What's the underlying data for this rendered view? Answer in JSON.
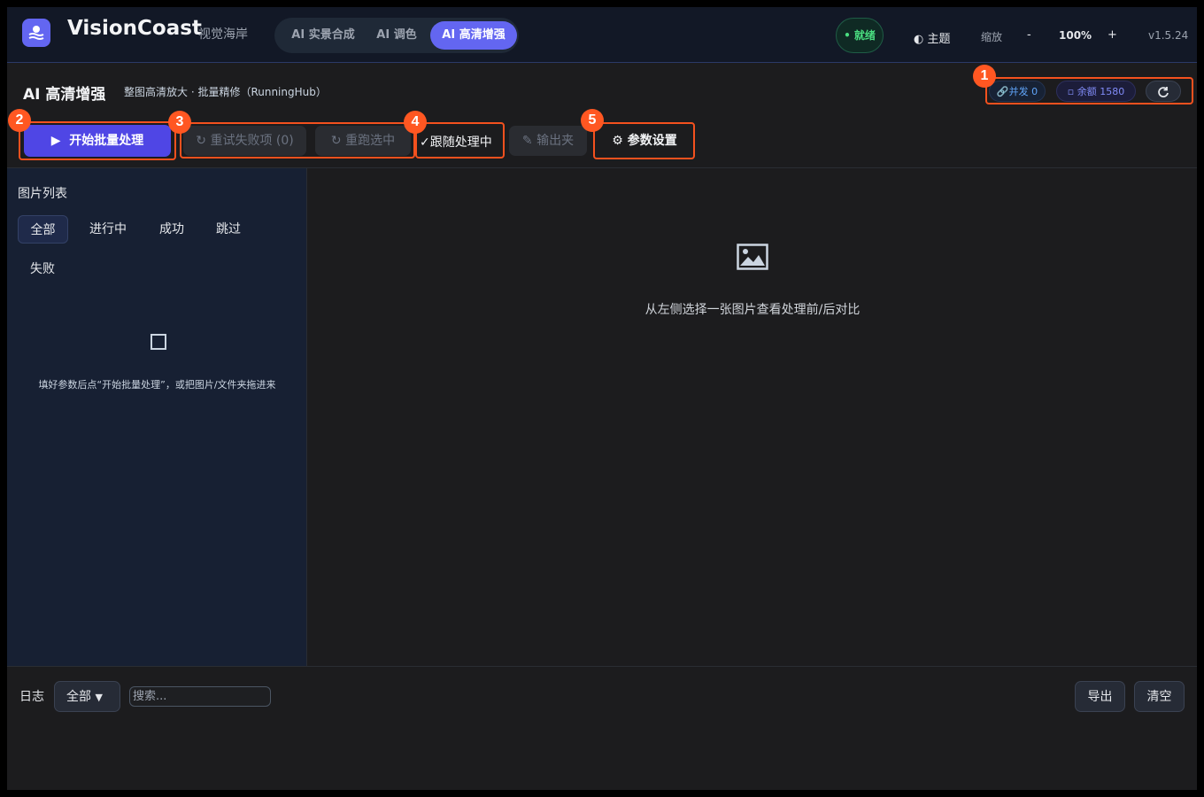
{
  "header": {
    "app_title": "VisionCoast",
    "app_subtitle": "视觉海岸",
    "tabs": [
      {
        "label": "AI 实景合成"
      },
      {
        "label": "AI 调色"
      },
      {
        "label": "AI 高清增强"
      }
    ],
    "status": "就绪",
    "theme_label": "主题",
    "zoom_label": "缩放",
    "zoom_minus": "-",
    "zoom_value": "100%",
    "zoom_plus": "+",
    "version": "v1.5.24"
  },
  "subheader": {
    "title": "AI 高清增强",
    "description": "整图高清放大 · 批量精修（RunningHub）",
    "concurrency": "并发 0",
    "balance": "余额 1580"
  },
  "toolbar": {
    "start_label": "开始批量处理",
    "retry_failed_label": "重试失败项 (0)",
    "rerun_selected_label": "重跑选中",
    "follow_label": "跟随处理中",
    "output_folder_label": "输出夹",
    "params_label": "参数设置"
  },
  "annotations": [
    "1",
    "2",
    "3",
    "4",
    "5"
  ],
  "image_list": {
    "title": "图片列表",
    "filters": [
      "全部",
      "进行中",
      "成功",
      "跳过",
      "失败"
    ],
    "empty_hint": "填好参数后点“开始批量处理”，或把图片/文件夹拖进来"
  },
  "preview": {
    "hint": "从左侧选择一张图片查看处理前/后对比"
  },
  "log": {
    "label": "日志",
    "filter_value": "全部",
    "search_placeholder": "搜索...",
    "export_label": "导出",
    "clear_label": "清空"
  },
  "colors": {
    "accent": "#6366f1",
    "status_green": "#4ade80",
    "annotation": "#f4511e"
  }
}
